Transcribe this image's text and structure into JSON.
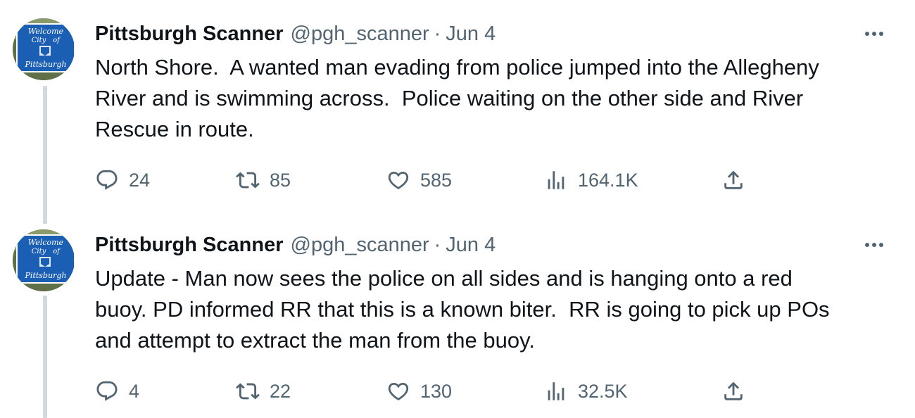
{
  "tweets": [
    {
      "display_name": "Pittsburgh Scanner",
      "handle": "@pgh_scanner",
      "separator": "·",
      "date": "Jun 4",
      "more_label": "•••",
      "text": "North Shore.  A wanted man evading from police jumped into the Allegheny\nRiver and is swimming across.  Police waiting on the other side and River\nRescue in route.",
      "avatar": {
        "line1": "Welcome",
        "line2": "City",
        "line3": "of",
        "line4": "Pittsburgh"
      },
      "replies": "24",
      "reposts": "85",
      "likes": "585",
      "views": "164.1K"
    },
    {
      "display_name": "Pittsburgh Scanner",
      "handle": "@pgh_scanner",
      "separator": "·",
      "date": "Jun 4",
      "more_label": "•••",
      "text": "Update - Man now sees the police on all sides and is hanging onto a red\nbuoy. PD informed RR that this is a known biter.  RR is going to pick up POs\nand attempt to extract the man from the buoy.",
      "avatar": {
        "line1": "Welcome",
        "line2": "City",
        "line3": "of",
        "line4": "Pittsburgh"
      },
      "replies": "4",
      "reposts": "22",
      "likes": "130",
      "views": "32.5K"
    }
  ],
  "icons": {
    "reply": "reply-icon",
    "repost": "repost-icon",
    "like": "heart-icon",
    "views": "views-icon",
    "share": "share-icon",
    "more": "more-icon"
  },
  "colors": {
    "text": "#0f1419",
    "secondary": "#536471",
    "thread_line": "#cfd9de",
    "sign_blue": "#1b5fb5"
  }
}
